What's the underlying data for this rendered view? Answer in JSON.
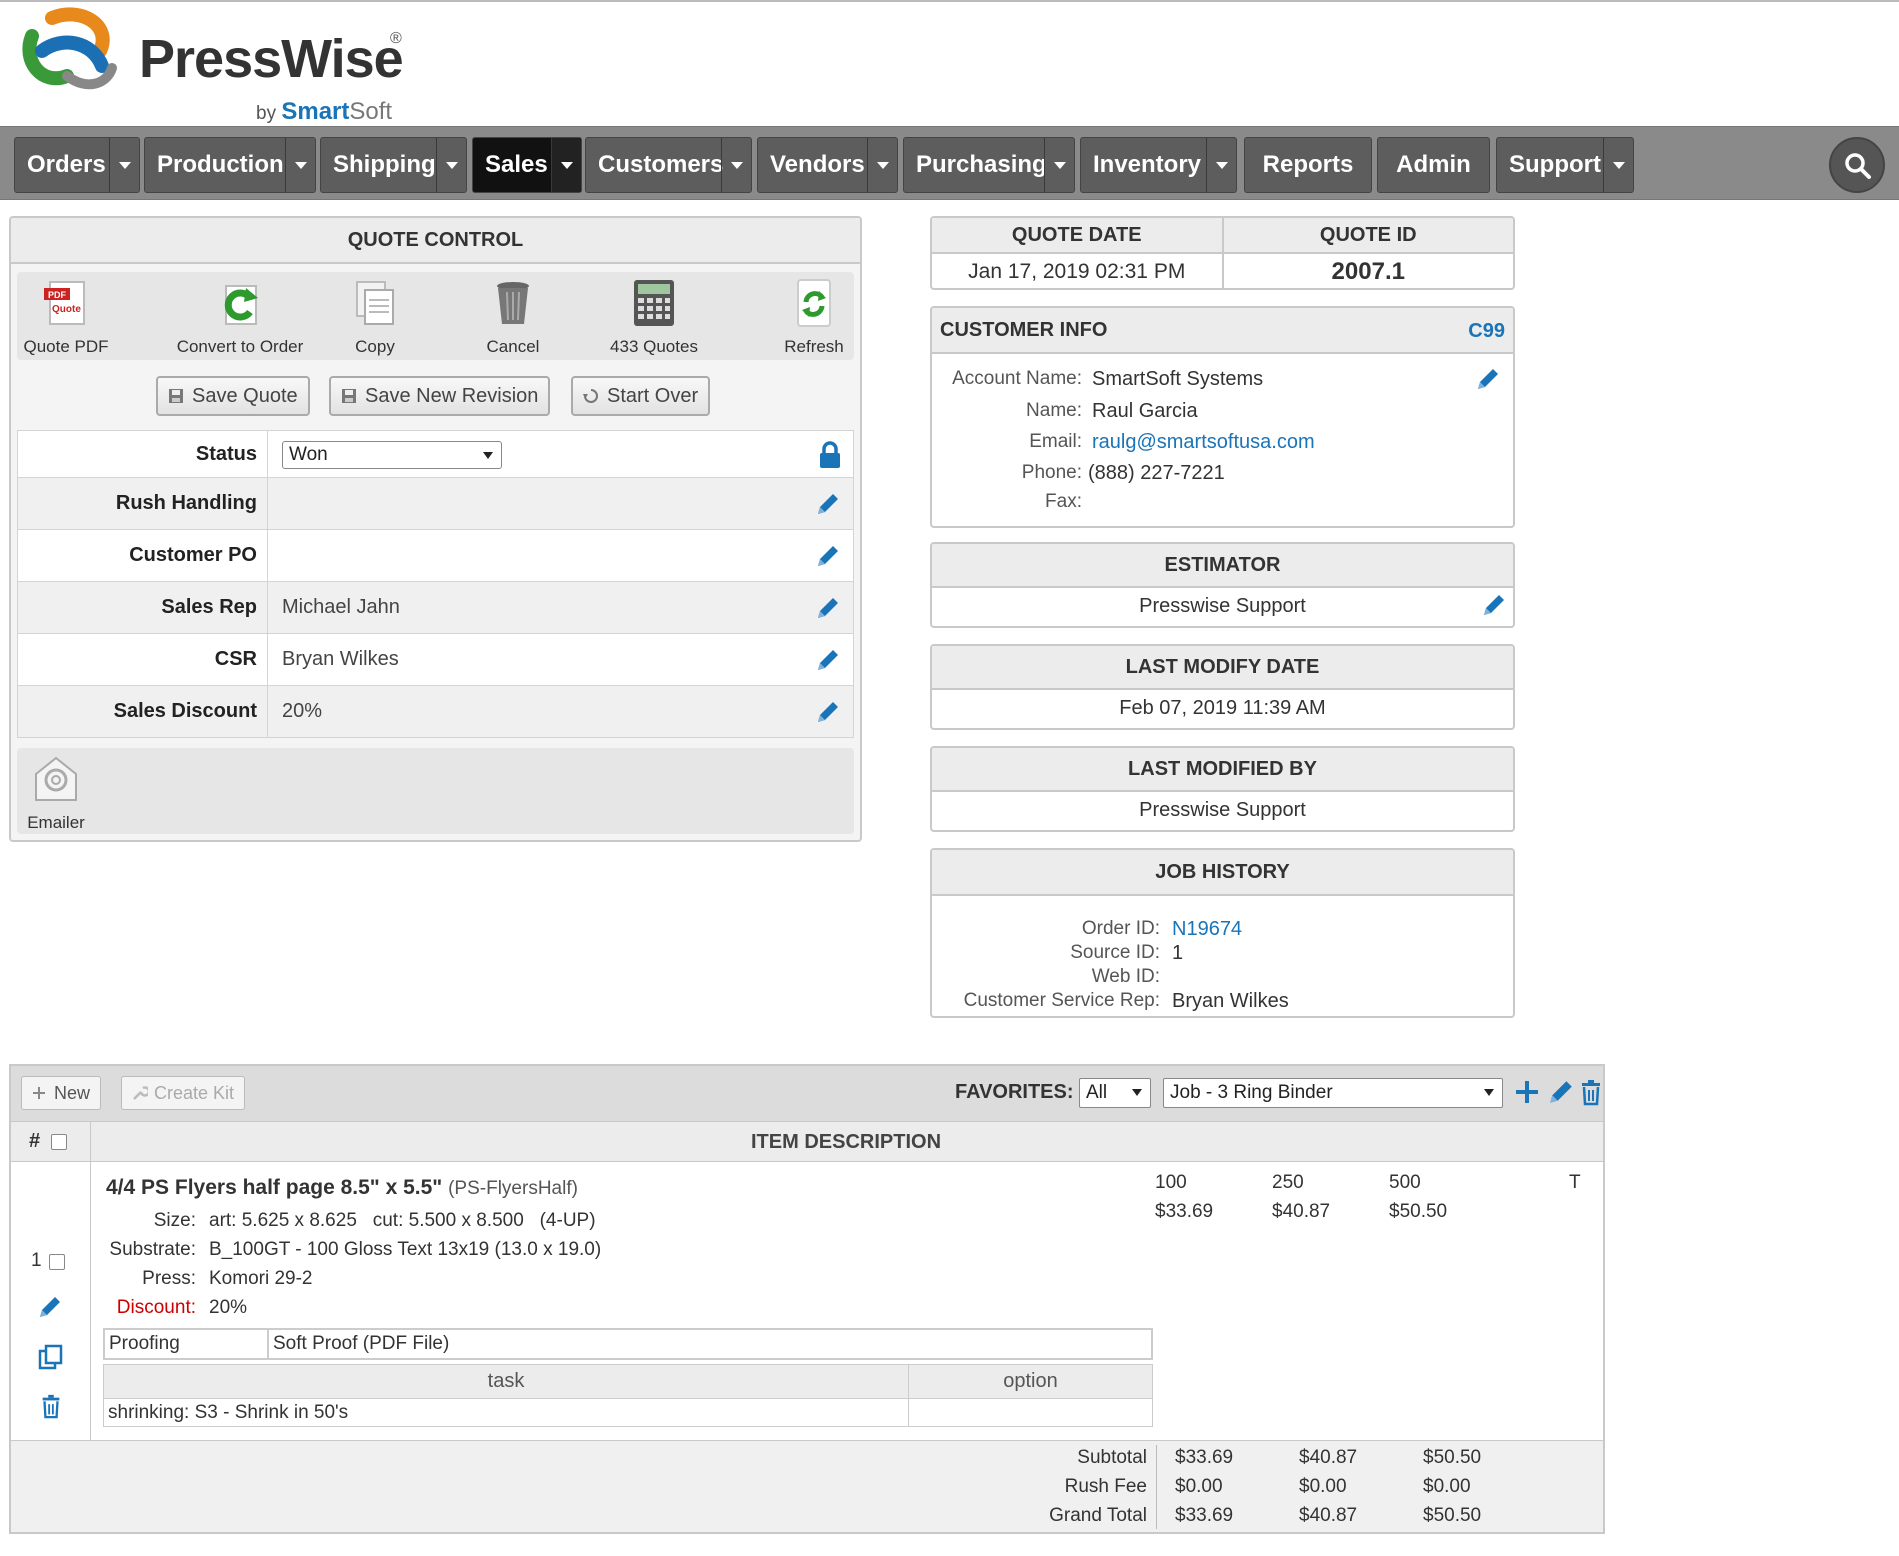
{
  "brand": {
    "name": "PressWise",
    "reg": "®",
    "by": "by",
    "by_brand_a": "Smart",
    "by_brand_b": "Soft"
  },
  "nav": [
    {
      "label": "Orders"
    },
    {
      "label": "Production"
    },
    {
      "label": "Shipping"
    },
    {
      "label": "Sales"
    },
    {
      "label": "Customers"
    },
    {
      "label": "Vendors"
    },
    {
      "label": "Purchasing"
    },
    {
      "label": "Inventory"
    },
    {
      "label": "Reports"
    },
    {
      "label": "Admin"
    },
    {
      "label": "Support"
    }
  ],
  "quote_control": {
    "title": "QUOTE CONTROL",
    "tools": {
      "quote_pdf": "Quote PDF",
      "convert": "Convert to Order",
      "copy": "Copy",
      "cancel": "Cancel",
      "quotes": "433 Quotes",
      "refresh": "Refresh"
    },
    "pdf_tag": "PDF",
    "pdf_sub": "Quote",
    "buttons": {
      "save": "Save Quote",
      "save_revision": "Save New Revision",
      "start_over": "Start Over"
    },
    "fields": {
      "status_label": "Status",
      "status_value": "Won",
      "rush_label": "Rush Handling",
      "po_label": "Customer PO",
      "rep_label": "Sales Rep",
      "rep_value": "Michael Jahn",
      "csr_label": "CSR",
      "csr_value": "Bryan Wilkes",
      "discount_label": "Sales Discount",
      "discount_value": "20%"
    },
    "emailer": "Emailer"
  },
  "quote_meta": {
    "date_label": "QUOTE DATE",
    "date_value": "Jan 17, 2019 02:31 PM",
    "id_label": "QUOTE ID",
    "id_value": "2007.1"
  },
  "customer": {
    "title": "CUSTOMER INFO",
    "id": "C99",
    "account_label": "Account Name:",
    "account_value": "SmartSoft Systems",
    "name_label": "Name:",
    "name_value": "Raul Garcia",
    "email_label": "Email:",
    "email_value": "raulg@smartsoftusa.com",
    "phone_label": "Phone:",
    "phone_value": "(888) 227-7221",
    "fax_label": "Fax:"
  },
  "estimator": {
    "title": "ESTIMATOR",
    "value": "Presswise Support"
  },
  "last_modify": {
    "title": "LAST MODIFY DATE",
    "value": "Feb 07, 2019 11:39 AM"
  },
  "last_modified_by": {
    "title": "LAST MODIFIED BY",
    "value": "Presswise Support"
  },
  "job_history": {
    "title": "JOB HISTORY",
    "order_label": "Order ID:",
    "order_value": "N19674",
    "source_label": "Source ID:",
    "source_value": "1",
    "web_label": "Web ID:",
    "csr_label": "Customer Service Rep:",
    "csr_value": "Bryan Wilkes"
  },
  "items": {
    "new_label": "New",
    "create_kit_label": "Create Kit",
    "favorites_label": "FAVORITES:",
    "favorites_filter": "All",
    "favorites_value": "Job - 3 Ring Binder",
    "hash": "#",
    "desc_header": "ITEM DESCRIPTION",
    "row_number": "1",
    "title": "4/4 PS Flyers half page 8.5\" x 5.5\"",
    "code": "(PS-FlyersHalf)",
    "size_label": "Size:",
    "size_value": "art: 5.625 x 8.625   cut: 5.500 x 8.500   (4-UP)",
    "substrate_label": "Substrate:",
    "substrate_value": "B_100GT - 100 Gloss Text 13x19 (13.0 x 19.0)",
    "press_label": "Press:",
    "press_value": "Komori 29-2",
    "discount_label": "Discount:",
    "discount_value": "20%",
    "proofing_label": "Proofing",
    "proofing_value": "Soft Proof (PDF File)",
    "task_header": "task",
    "option_header": "option",
    "task_value": "shrinking: S3 - Shrink in 50's",
    "t_label": "T",
    "qtys": [
      "100",
      "250",
      "500"
    ],
    "prices": [
      "$33.69",
      "$40.87",
      "$50.50"
    ],
    "subtotal_label": "Subtotal",
    "subtotals": [
      "$33.69",
      "$40.87",
      "$50.50"
    ],
    "rush_label": "Rush Fee",
    "rush": [
      "$0.00",
      "$0.00",
      "$0.00"
    ],
    "grand_label": "Grand Total",
    "grand": [
      "$33.69",
      "$40.87",
      "$50.50"
    ]
  },
  "colors": {
    "accent": "#1a74b8",
    "nav_bg": "#8a8a8a",
    "nav_item": "#5d5d5d",
    "nav_active": "#111111",
    "danger": "#cc0000"
  }
}
